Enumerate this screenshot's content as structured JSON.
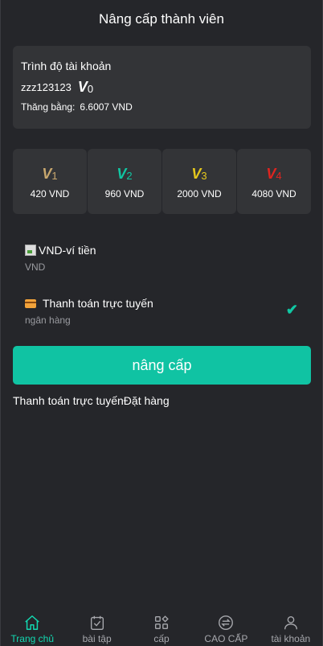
{
  "header": {
    "title": "Nâng cấp thành viên"
  },
  "account": {
    "title": "Trình độ tài khoản",
    "username": "zzz123123",
    "level_letter": "V",
    "level_number": "0",
    "balance_label": "Thăng bằng:",
    "balance_value": "6.6007 VND"
  },
  "levels": [
    {
      "letter": "V",
      "number": "1",
      "price": "420 VND",
      "color": "#c9a86e"
    },
    {
      "letter": "V",
      "number": "2",
      "price": "960 VND",
      "color": "#10c7a3"
    },
    {
      "letter": "V",
      "number": "3",
      "price": "2000 VND",
      "color": "#e6c81c"
    },
    {
      "letter": "V",
      "number": "4",
      "price": "4080 VND",
      "color": "#e0241f"
    }
  ],
  "payment": {
    "wallet": {
      "label": "VND-ví tiền",
      "sub": "VND"
    },
    "online": {
      "label": "Thanh toán trực tuyến",
      "sub": "ngân hàng"
    }
  },
  "upgrade_button": "nâng cấp",
  "links": {
    "online": "Thanh toán trực tuyến",
    "order": "Đặt hàng"
  },
  "tabbar": [
    {
      "label": "Trang chủ",
      "icon": "home-icon",
      "active": true
    },
    {
      "label": "bài tập",
      "icon": "tasks-icon",
      "active": false
    },
    {
      "label": "cấp",
      "icon": "grid-icon",
      "active": false
    },
    {
      "label": "CAO CẤP",
      "icon": "exchange-icon",
      "active": false
    },
    {
      "label": "tài khoản",
      "icon": "user-icon",
      "active": false
    }
  ],
  "colors": {
    "accent": "#10c3a3",
    "background": "#25262a",
    "card": "#333437"
  }
}
